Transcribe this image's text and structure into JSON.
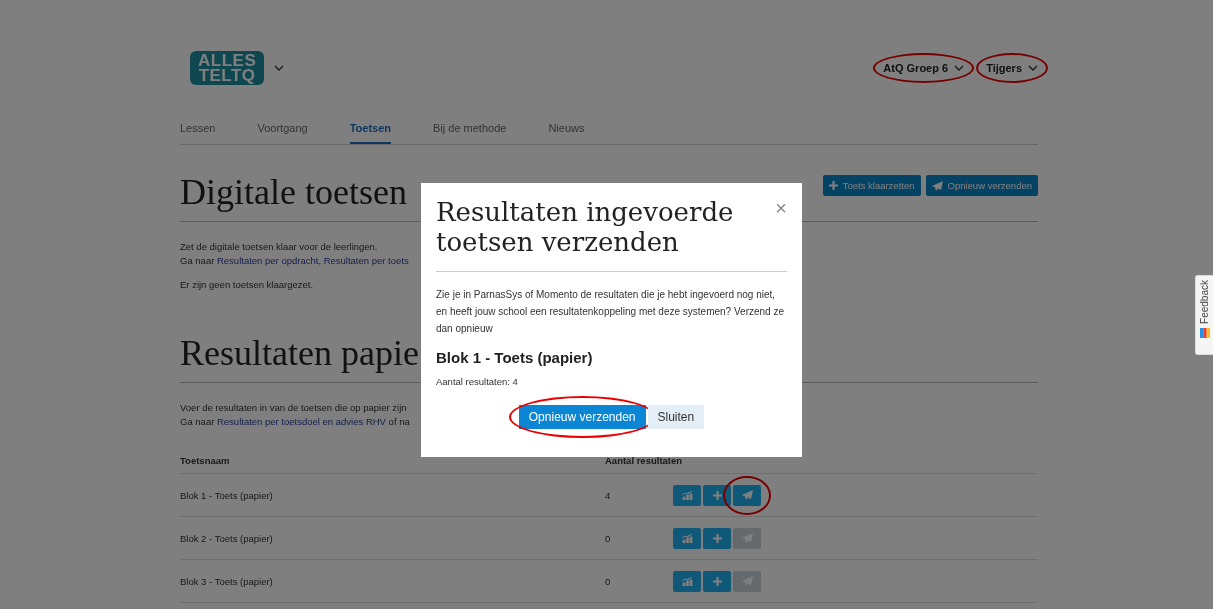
{
  "logo": {
    "line1": "ALLES",
    "line2": "TELTQ"
  },
  "account_selectors": [
    {
      "label": "AtQ Groep 6",
      "highlighted": true
    },
    {
      "label": "Tijgers",
      "highlighted": true
    }
  ],
  "tabs": [
    {
      "label": "Lessen",
      "selected": false
    },
    {
      "label": "Voortgang",
      "selected": false
    },
    {
      "label": "Toetsen",
      "selected": true
    },
    {
      "label": "Bij de methode",
      "selected": false
    },
    {
      "label": "Nieuws",
      "selected": false
    }
  ],
  "digital_section": {
    "title": "Digitale toetsen",
    "actions": [
      {
        "kind": "add",
        "label": "Toets klaarzetten"
      },
      {
        "kind": "send",
        "label": "Opnieuw verzenden"
      }
    ],
    "intro": "Zet de digitale toetsen klaar voor de leerlingen.",
    "links_line": [
      {
        "text": "Ga naar ",
        "kind": "text"
      },
      {
        "text": "Resultaten per opdracht",
        "kind": "link"
      },
      {
        "text": ", ",
        "kind": "text"
      },
      {
        "text": "Resultaten per toets",
        "kind": "link"
      }
    ],
    "empty_text": "Er zijn geen toetsen klaargezet."
  },
  "paper_section": {
    "title": "Resultaten papie",
    "intro": "Voer de resultaten in van de toetsen die op papier zijn",
    "links_line": [
      {
        "text": "Ga naar ",
        "kind": "text"
      },
      {
        "text": "Resultaten per toetsdoel en advies RHV",
        "kind": "link"
      },
      {
        "text": " of na",
        "kind": "text"
      }
    ],
    "table": {
      "columns": [
        "Toetsnaam",
        "Aantal resultaten"
      ],
      "rows": [
        {
          "name": "Blok 1 - Toets (papier)",
          "count": "4",
          "send_enabled": true,
          "highlighted": true
        },
        {
          "name": "Blok 2 - Toets (papier)",
          "count": "0",
          "send_enabled": false,
          "highlighted": false
        },
        {
          "name": "Blok 3 - Toets (papier)",
          "count": "0",
          "send_enabled": false,
          "highlighted": false
        }
      ]
    }
  },
  "modal": {
    "title": "Resultaten ingevoerde toetsen verzenden",
    "close": "×",
    "body": "Zie je in ParnasSys of Momento de resultaten die je hebt ingevoerd nog niet, en heeft jouw school een resultatenkoppeling met deze systemen? Verzend ze dan opnieuw",
    "test_name": "Blok 1 - Toets (papier)",
    "count_text": "Aantal resultaten: 4",
    "buttons": [
      {
        "kind": "primary",
        "label": "Opnieuw verzenden",
        "highlighted": true
      },
      {
        "kind": "secondary",
        "label": "Sluiten",
        "highlighted": false
      }
    ]
  },
  "feedback": {
    "label": "Feedback"
  }
}
